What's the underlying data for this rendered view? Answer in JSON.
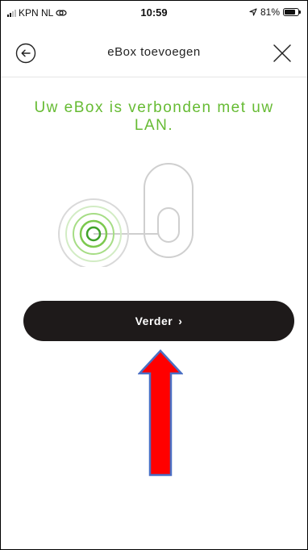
{
  "status_bar": {
    "carrier": "KPN NL",
    "time": "10:59",
    "battery_percent": "81%",
    "battery_level": 0.81,
    "icons": [
      "signal-icon",
      "link-icon",
      "location-arrow-icon",
      "battery-icon"
    ]
  },
  "header": {
    "title": "eBox toevoegen",
    "back_icon": "arrow-left-circle-icon",
    "close_icon": "close-icon"
  },
  "content": {
    "headline": "Uw eBox is verbonden met uw LAN.",
    "illustration": "ebox-lan-connected-icon"
  },
  "next_button": {
    "label": "Verder",
    "chevron": "›"
  },
  "colors": {
    "accent_green": "#66bb33",
    "button_dark": "#1e1a1a",
    "annotation_red": "#ff0000",
    "annotation_blue": "#4a6fc4"
  }
}
